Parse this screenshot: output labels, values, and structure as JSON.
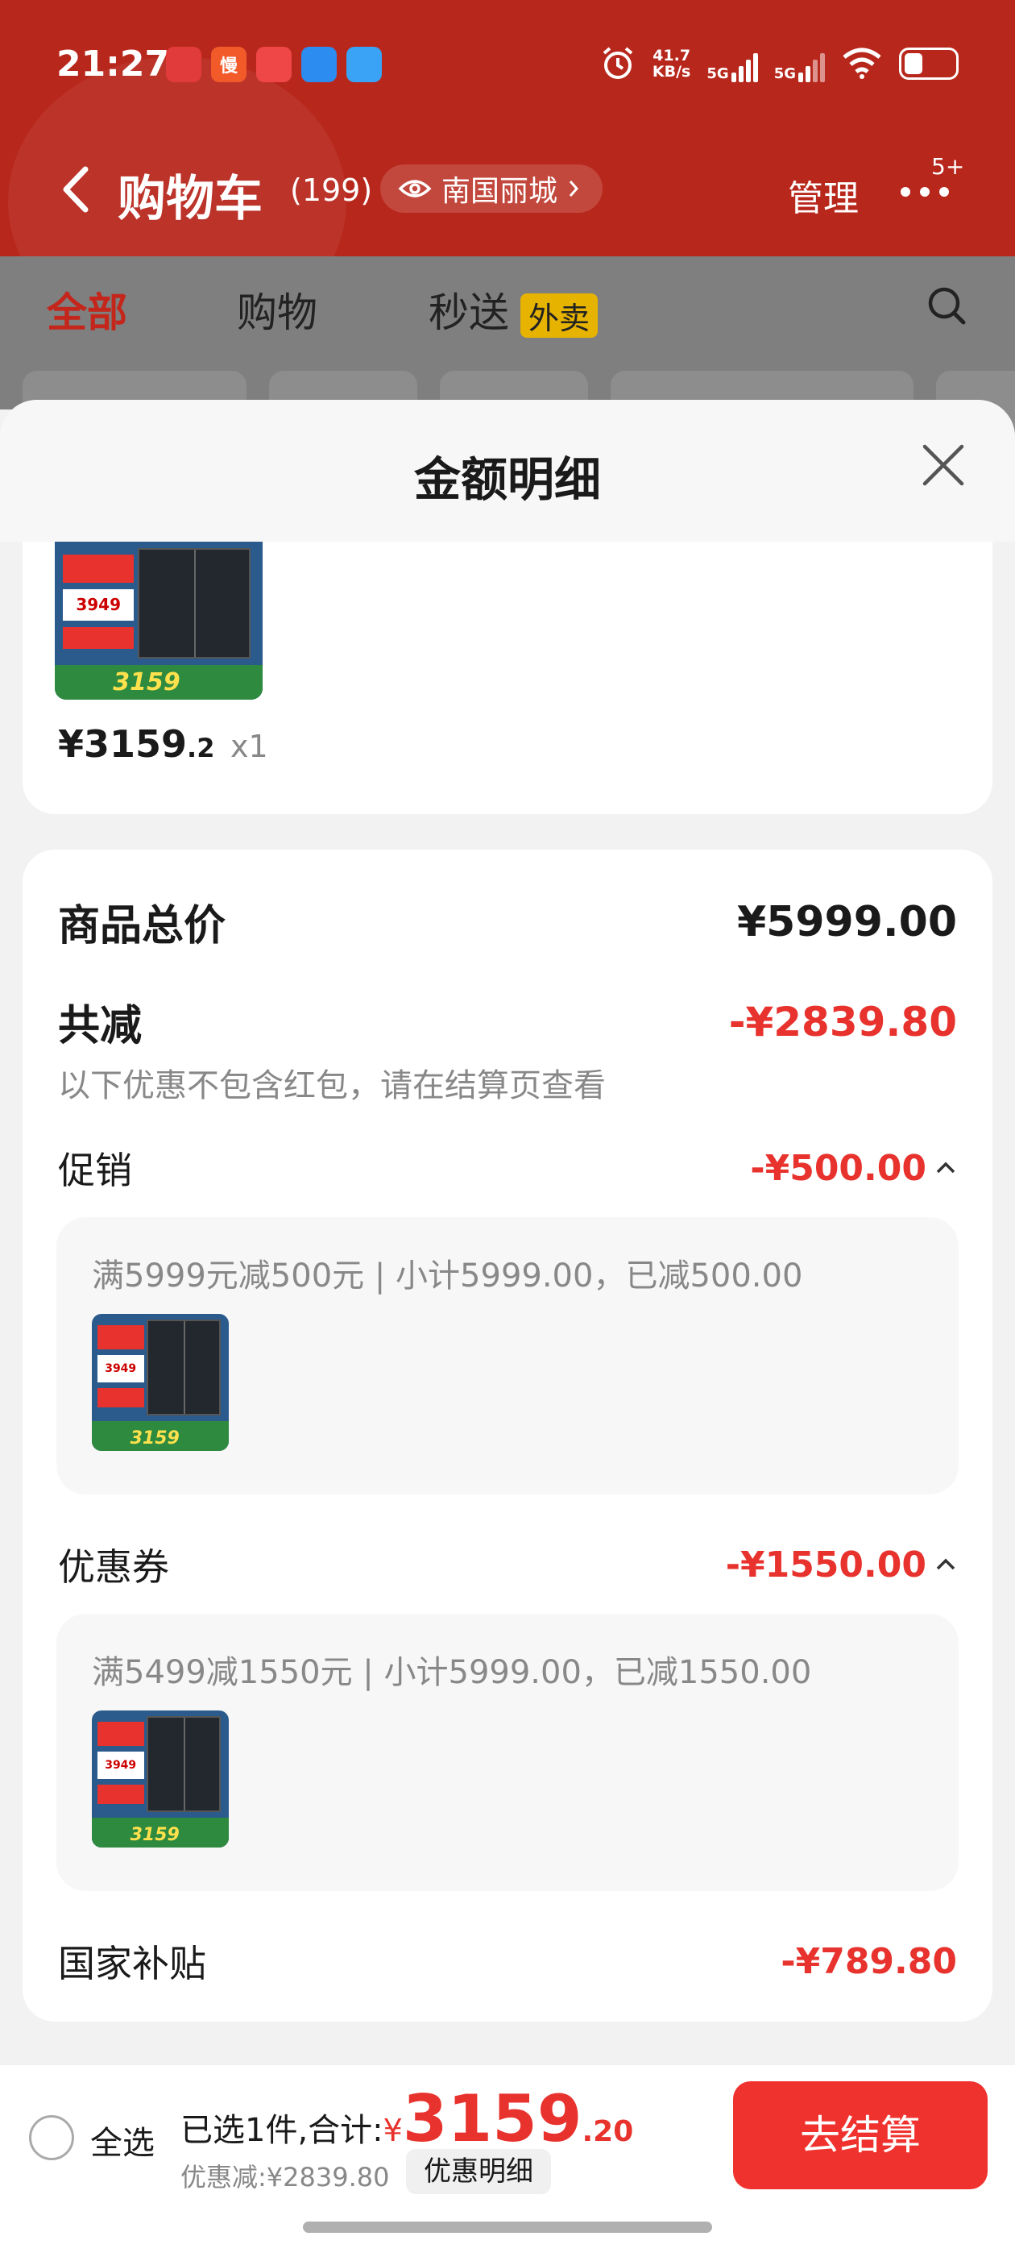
{
  "status_bar": {
    "time": "21:27",
    "net_speed_value": "41.7",
    "net_speed_unit": "KB/s",
    "signal1": "5G",
    "signal2": "5G",
    "app_icons": [
      "red-app-icon",
      "slow-app-icon",
      "douyin-icon",
      "blue-app-icon",
      "qq-icon"
    ],
    "app_icon_texts": [
      "",
      "慢",
      "",
      "",
      ""
    ]
  },
  "header": {
    "title": "购物车",
    "count": "(199)",
    "location": "南国丽城",
    "manage": "管理",
    "more_badge": "5+"
  },
  "tabs": {
    "items": [
      "全部",
      "购物",
      "秒送"
    ],
    "waimai_badge": "外卖"
  },
  "sheet": {
    "title": "金额明细",
    "item": {
      "price_main": "¥3159",
      "price_dec": ".2",
      "qty": "x1",
      "thumb_price_top": "3949",
      "thumb_price_bottom": "3159"
    },
    "summary": {
      "total_label": "商品总价",
      "total_value": "¥5999.00",
      "reduce_label": "共减",
      "reduce_value": "-¥2839.80",
      "hint": "以下优惠不包含红包，请在结算页查看",
      "promo_label": "促销",
      "promo_value": "-¥500.00",
      "promo_detail": "满5999元减500元 | 小计5999.00，已减500.00",
      "coupon_label": "优惠券",
      "coupon_value": "-¥1550.00",
      "coupon_detail": "满5499减1550元 | 小计5999.00，已减1550.00",
      "subsidy_label": "国家补贴",
      "subsidy_value": "-¥789.80"
    }
  },
  "bottom_bar": {
    "select_all": "全选",
    "total_prefix": "已选1件,合计:",
    "total_yen": "¥",
    "total_int": "3159",
    "total_dec": ".20",
    "discount": "优惠减:¥2839.80",
    "detail_button": "优惠明细",
    "checkout": "去结算"
  },
  "colors": {
    "header_red": "#b8271c",
    "accent_red": "#e8322d",
    "checkout_red": "#f0322e"
  }
}
